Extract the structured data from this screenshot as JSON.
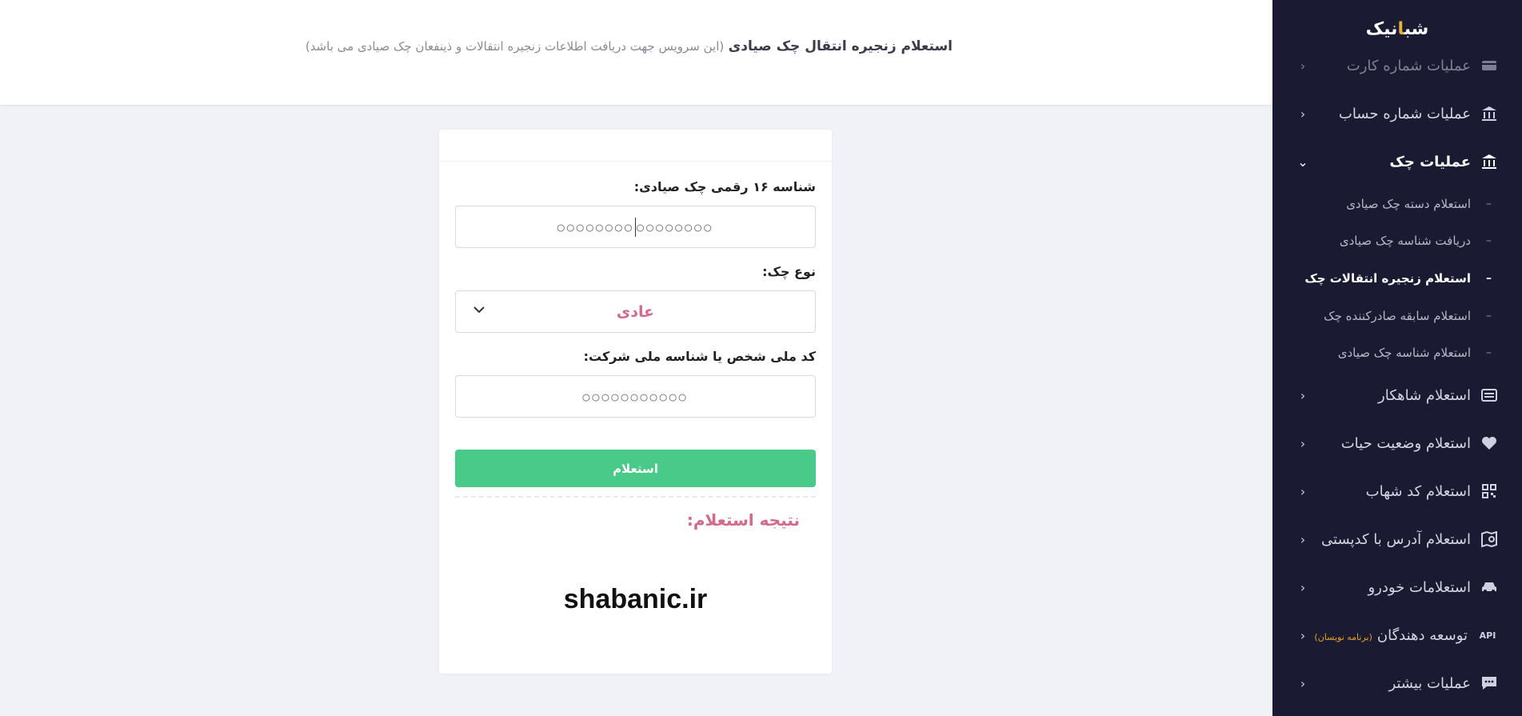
{
  "brand": {
    "logo_prefix": "شب",
    "logo_dot": "ا",
    "logo_suffix": "نیک"
  },
  "header": {
    "title": "استعلام زنجیره انتقال چک صیادی",
    "subtitle": "(این سرویس جهت دریافت اطلاعات زنجیره انتقالات و ذینفعان چک صیادی می باشد)"
  },
  "sidebar": {
    "items": [
      {
        "label": "عملیات شماره کارت",
        "icon": "card-icon"
      },
      {
        "label": "عملیات شماره حساب",
        "icon": "bank-icon"
      },
      {
        "label": "عملیات چک",
        "icon": "bank-icon"
      },
      {
        "label": "استعلام شاهکار",
        "icon": "id-card-icon"
      },
      {
        "label": "استعلام وضعیت حیات",
        "icon": "heart-icon"
      },
      {
        "label": "استعلام کد شهاب",
        "icon": "qr-icon"
      },
      {
        "label": "استعلام آدرس با کدپستی",
        "icon": "map-search-icon"
      },
      {
        "label": "استعلامات خودرو",
        "icon": "car-icon"
      },
      {
        "label": "توسعه دهندگان",
        "note": "(برنامه نویسان)",
        "icon": "api-icon",
        "icon_text": "API"
      },
      {
        "label": "عملیات بیشتر",
        "icon": "chat-icon"
      }
    ],
    "sub_items": [
      {
        "label": "استعلام دسته چک صیادی"
      },
      {
        "label": "دریافت شناسه چک صیادی"
      },
      {
        "label": "استعلام زنجیره انتقالات چک",
        "active": true
      },
      {
        "label": "استعلام سابقه صادرکننده چک"
      },
      {
        "label": "استعلام شناسه چک صیادی"
      }
    ]
  },
  "form": {
    "cheque_id_label": "شناسه ۱۶ رقمی چک صیادی:",
    "cheque_id_value_left": "○○○○○○○○",
    "cheque_id_value_right": "○○○○○○○○",
    "cheque_type_label": "نوع چک:",
    "cheque_type_value": "عادی",
    "national_id_label": "کد ملی شخص یا شناسه ملی شرکت:",
    "national_id_value": "○○○○○○○○○○○",
    "submit_label": "استعلام",
    "result_label": "نتیجه استعلام:",
    "watermark": "shabanic.ir"
  },
  "colors": {
    "sidebar_bg": "#1b1a33",
    "accent_green": "#49ca89",
    "accent_pink": "#d36a8c",
    "logo_dot": "#e4b535",
    "note_orange": "#e4a21b"
  }
}
